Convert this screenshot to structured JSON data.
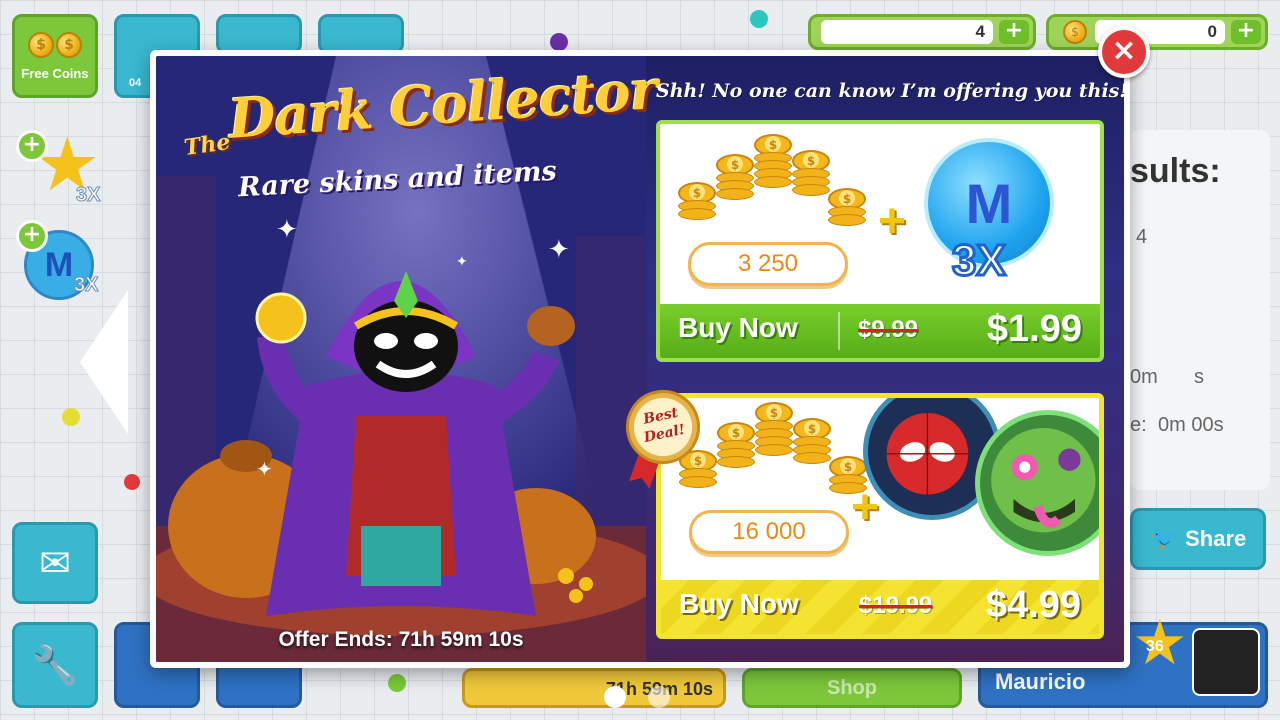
{
  "hud": {
    "free_coins_label": "Free Coins",
    "bone_count": "4",
    "coin_count": "0",
    "plus_symbol": "+",
    "side_boost_1": "3X",
    "side_boost_2": "3X",
    "tile_caption": "04",
    "results_fragment": "sults:",
    "results_line_1": "4",
    "results_line_2": "0m",
    "results_line_2b": "s",
    "results_line_3": "e:",
    "results_line_3b": "0m 00s",
    "share_label": "Share",
    "player_name": "Mauricio",
    "player_level": "36",
    "shop_label": "Shop",
    "bottom_timer": "71h 59m 10s"
  },
  "offer": {
    "title_the": "The",
    "title_main": "Dark Collector",
    "title_sub": "Rare skins and items",
    "secret_line": "Shh! No one can know I’m offering you this!",
    "ends": "Offer Ends: 71h 59m 10s",
    "close_symbol": "×",
    "packs": [
      {
        "coins": "3 250",
        "plus_symbol": "+",
        "item_letter": "M",
        "multiplier": "3X",
        "buy_label": "Buy Now",
        "old_price": "$9.99",
        "price": "$1.99"
      },
      {
        "badge": "Best Deal!",
        "coins": "16 000",
        "plus_symbol": "+",
        "buy_label": "Buy Now",
        "old_price": "$19.99",
        "price": "$4.99"
      }
    ]
  },
  "colors": {
    "accent_green": "#79cf2b",
    "accent_yellow": "#f4e431",
    "close_red": "#e23a3a",
    "coin_amber": "#ea8a16",
    "backdrop_navy": "#1e1f63"
  }
}
